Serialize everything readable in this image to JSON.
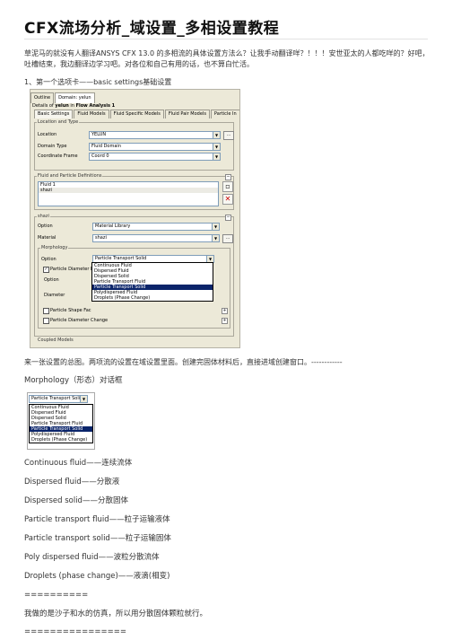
{
  "title": "CFX流场分析_域设置_多相设置教程",
  "intro": "草泥马的就没有人翻译ANSYS CFX 13.0 的多相流的具体设置方法么？让我手动翻译咩？！！！安世亚太的人都吃咩的？好吧，吐槽结束，我边翻译边学习吧。对各位和自己有用的话，也不算白忙活。",
  "step1": "1、第一个选项卡——basic settings基础设置",
  "shot1": {
    "tabs": [
      "Outline",
      "Domain: yelun"
    ],
    "details_prefix": "Details of",
    "details_domain": "yelun",
    "details_in": "in",
    "details_analysis": "Flow Analysis 1",
    "subtabs": [
      "Basic Settings",
      "Fluid Models",
      "Fluid Specific Models",
      "Fluid Pair Models",
      "Particle In"
    ],
    "location_and_type": "Location and Type",
    "location_label": "Location",
    "location_value": "YELUN",
    "domain_type_label": "Domain Type",
    "domain_type_value": "Fluid Domain",
    "coord_frame_label": "Coordinate Frame",
    "coord_frame_value": "Coord 0",
    "fluid_defs_label": "Fluid and Particle Definitions",
    "fluid_list": [
      "Fluid 1",
      "shazi"
    ],
    "shazi_label": "shazi",
    "option_label": "Option",
    "option_value": "Material Library",
    "material_label": "Material",
    "material_value": "shazi",
    "morphology_label": "Morphology",
    "morph_option_label": "Option",
    "morph_option_value": "Particle Transport Solid",
    "particle_diameter_label": "Particle Diameter D",
    "pd_option_label": "Option",
    "diameter_label": "Diameter",
    "particle_shape_label": "Particle Shape Fac",
    "particle_diameter_change_label": "Particle Diameter Change",
    "coupled_models_label": "Coupled Models",
    "dropdown_items": [
      "Continuous Fluid",
      "Dispersed Fluid",
      "Dispersed Solid",
      "Particle Transport Fluid",
      "Particle Transport Solid",
      "Polydispersed Fluid",
      "Droplets (Phase Change)"
    ],
    "dots_label": "..."
  },
  "caption1": "来一张设置的总图。两项流的设置在域设置里面。创建完固体材料后，直接进域创建窗口。------------",
  "morph_heading": "Morphology（形态）对话框",
  "shot2": {
    "combo_value": "Particle Transport Solid",
    "items": [
      "Continuous Fluid",
      "Dispersed Fluid",
      "Dispersed Solid",
      "Particle Transport Fluid",
      "Particle Transport Solid",
      "Polydispersed Fluid",
      "Droplets (Phase Change)"
    ]
  },
  "definitions": [
    "Continuous fluid——连续流体",
    "Dispersed fluid——分散液",
    "Dispersed solid——分散固体",
    "Particle transport fluid——粒子运输液体",
    "Particle transport solid——粒子运输固体",
    "Poly dispersed fluid——波粒分散流体",
    "Droplets (phase change)——液滴(相变)"
  ],
  "sep1": "==========",
  "conclusion": "我做的是沙子和水的仿真，所以用分散固体颗粒就行。",
  "sep2": "================"
}
